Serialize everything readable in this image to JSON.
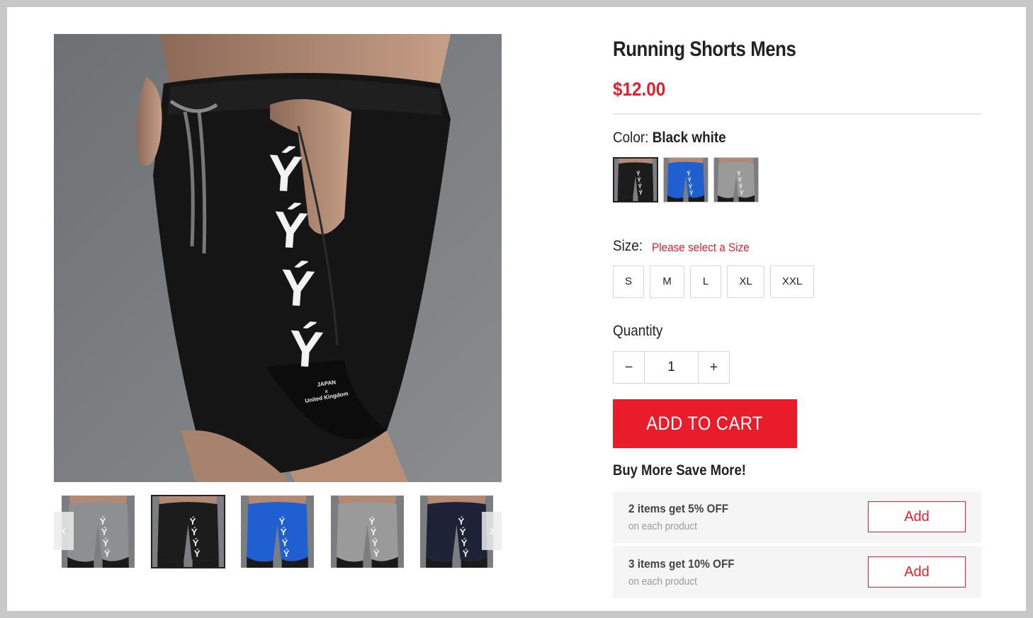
{
  "product": {
    "title": "Running Shorts Mens",
    "price": "$12.00",
    "main_image_text": {
      "brand_mark": "ÝÝÝÝ",
      "caption_line1": "JAPAN",
      "caption_line2": "x",
      "caption_line3": "United Kingdom"
    }
  },
  "gallery": {
    "prev_arrow": "‹",
    "next_arrow": "›",
    "thumbnails": [
      {
        "color": "#8e8f92"
      },
      {
        "color": "#1c1c1c"
      },
      {
        "color": "#1f5fd0"
      },
      {
        "color": "#9a9a9a"
      },
      {
        "color": "#1d2236"
      }
    ],
    "active_index": 1
  },
  "color": {
    "label": "Color:",
    "selected": "Black white",
    "swatches": [
      {
        "color": "#1c1c1c"
      },
      {
        "color": "#1f5fd0"
      },
      {
        "color": "#9a9a9a"
      }
    ]
  },
  "size": {
    "label": "Size:",
    "warning": "Please select a Size",
    "options": [
      "S",
      "M",
      "L",
      "XL",
      "XXL"
    ]
  },
  "quantity": {
    "label": "Quantity",
    "value": "1",
    "minus": "−",
    "plus": "+"
  },
  "cart": {
    "label": "ADD TO CART"
  },
  "bulk": {
    "title": "Buy More Save More!",
    "offers": [
      {
        "title": "2 items get 5% OFF",
        "sub": "on each product",
        "button": "Add"
      },
      {
        "title": "3 items get 10% OFF",
        "sub": "on each product",
        "button": "Add"
      }
    ]
  },
  "colors": {
    "accent": "#e81c2a",
    "price": "#e4202e"
  }
}
